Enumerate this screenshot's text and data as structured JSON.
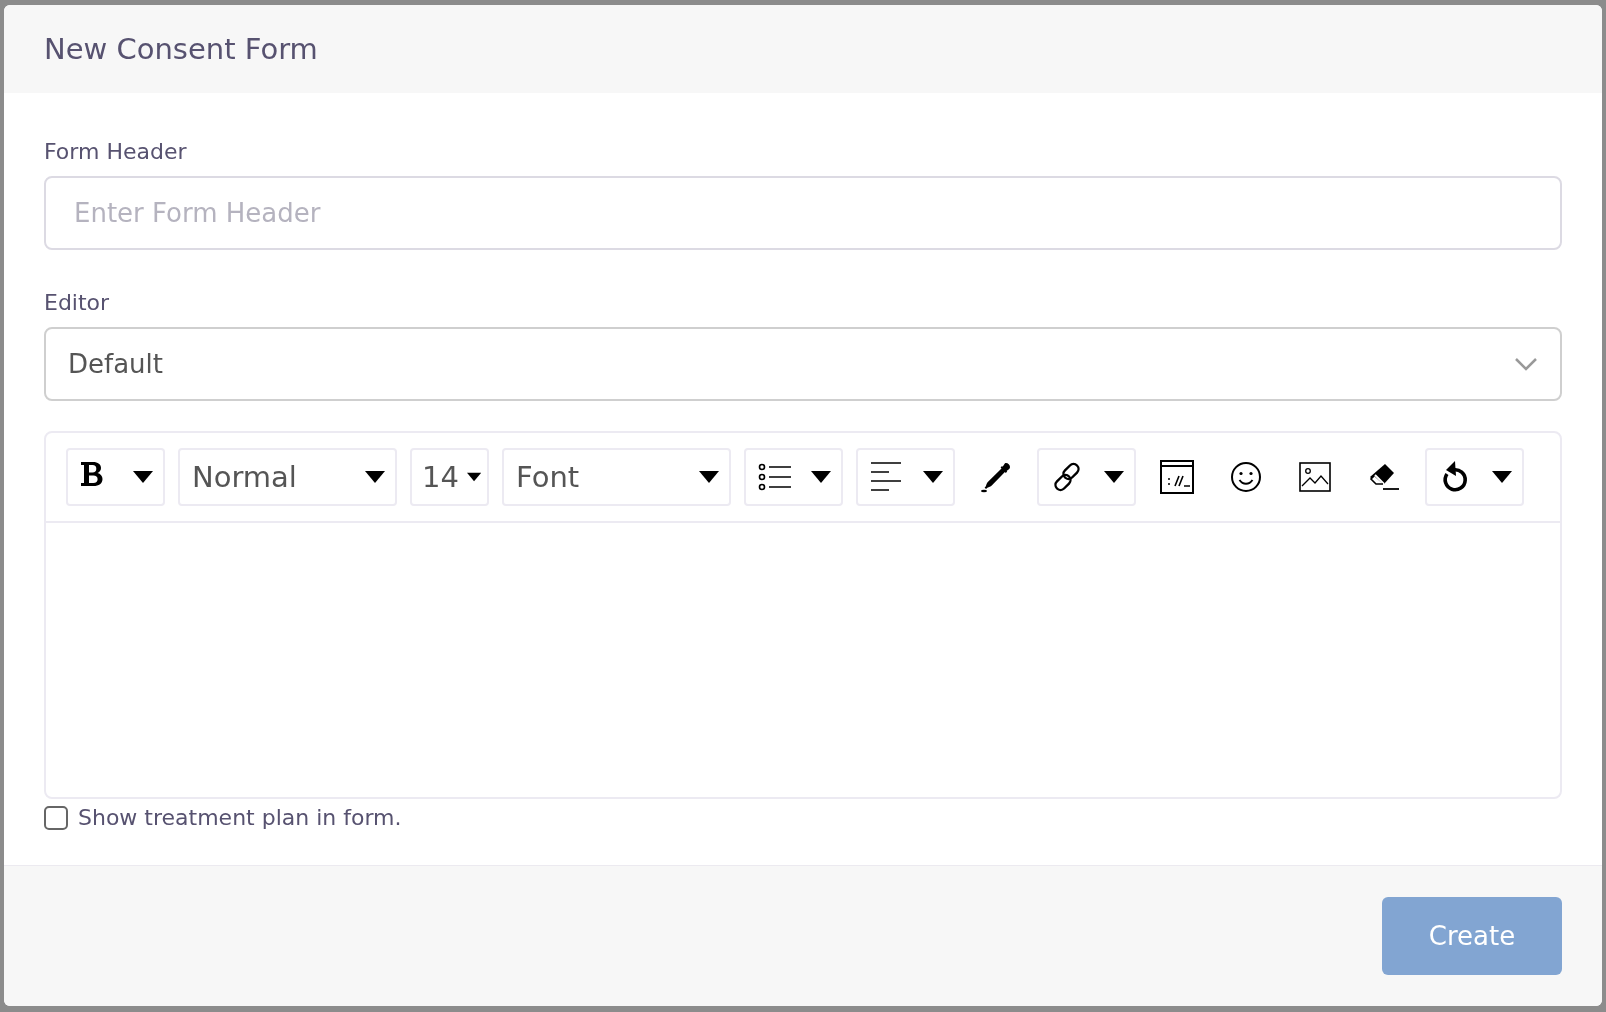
{
  "dialog": {
    "title": "New Consent Form"
  },
  "form_header": {
    "label": "Form Header",
    "placeholder": "Enter Form Header"
  },
  "editor": {
    "label": "Editor",
    "value": "Default"
  },
  "toolbar": [
    {
      "kind": "icon-dropdown"
    },
    {
      "kind": "text-dropdown",
      "label": "Normal"
    },
    {
      "kind": "text-dropdown",
      "label": "14"
    },
    {
      "kind": "text-dropdown",
      "label": "Font"
    },
    {
      "kind": "icon-dropdown"
    },
    {
      "kind": "icon-dropdown"
    },
    {
      "kind": "icon"
    },
    {
      "kind": "icon-dropdown"
    },
    {
      "kind": "icon"
    },
    {
      "kind": "icon"
    },
    {
      "kind": "icon"
    },
    {
      "kind": "icon"
    },
    {
      "kind": "icon-dropdown"
    }
  ],
  "show_treatment_plan": {
    "label": "Show treatment plan in form.",
    "checked": false
  },
  "create_button": {
    "label": "Create",
    "disabled": true
  }
}
